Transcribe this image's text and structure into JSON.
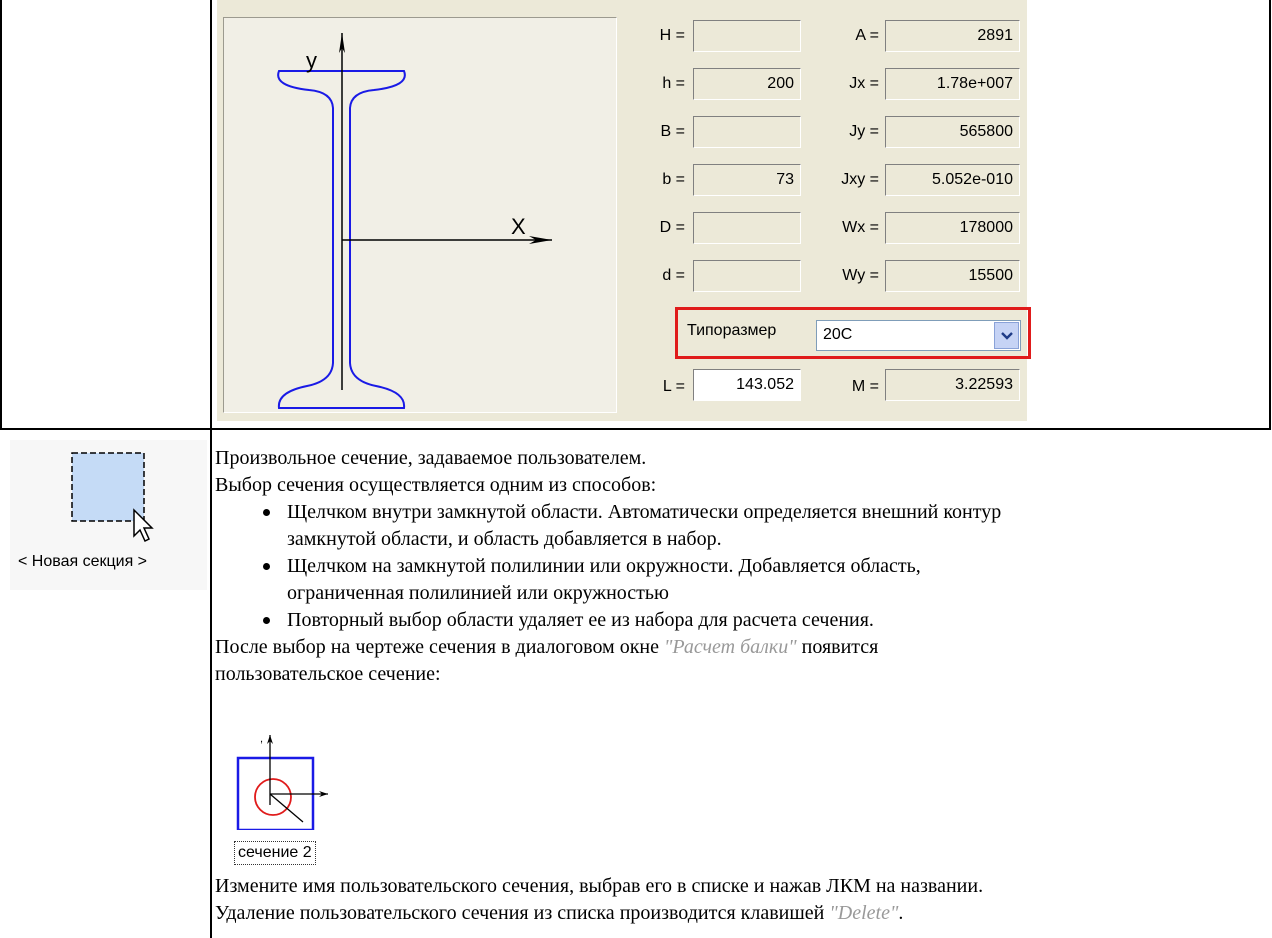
{
  "section_panel": {
    "fields": {
      "H": {
        "label": "H =",
        "value": ""
      },
      "h": {
        "label": "h =",
        "value": "200"
      },
      "B": {
        "label": "B =",
        "value": ""
      },
      "b": {
        "label": "b =",
        "value": "73"
      },
      "D": {
        "label": "D =",
        "value": ""
      },
      "d": {
        "label": "d =",
        "value": ""
      },
      "L": {
        "label": "L =",
        "value": "143.052"
      },
      "A": {
        "label": "A =",
        "value": "2891"
      },
      "Jx": {
        "label": "Jx =",
        "value": "1.78e+007"
      },
      "Jy": {
        "label": "Jy =",
        "value": "565800"
      },
      "Jxy": {
        "label": "Jxy =",
        "value": "5.052e-010"
      },
      "Wx": {
        "label": "Wx =",
        "value": "178000"
      },
      "Wy": {
        "label": "Wy =",
        "value": "15500"
      },
      "M": {
        "label": "M =",
        "value": "3.22593"
      }
    },
    "typesize": {
      "label": "Типоразмер",
      "value": "20С"
    },
    "preview": {
      "axis_y": "y",
      "axis_x": "X"
    },
    "colors": {
      "highlight": "#e01b1b",
      "profile": "#1a1ae6"
    }
  },
  "new_section": {
    "label": "< Новая секция >"
  },
  "description": {
    "line1": "Произвольное сечение, задаваемое пользователем.",
    "line2": "Выбор сечения осуществляется одним из способов:",
    "bullets": [
      {
        "l1": "Щелчком внутри замкнутой области. Автоматически определяется внешний контур",
        "l2": "замкнутой области, и область добавляется в набор."
      },
      {
        "l1": "Щелчком на замкнутой полилинии или окружности. Добавляется область,",
        "l2": "ограниченная полилинией или окружностью"
      },
      {
        "l1": "Повторный выбор области удаляет ее из набора для расчета сечения.",
        "l2": ""
      }
    ],
    "after_pre": "После выбор на чертеже сечения в диалоговом окне ",
    "after_ref": "\"Расчет балки\"",
    "after_post": " появится",
    "after_line2": "пользовательское сечение:",
    "user_section_label": "сечение 2",
    "rename_line": "Измените имя пользовательского сечения, выбрав его в списке и нажав ЛКМ на названии.",
    "delete_pre": "Удаление пользовательского сечения из списка производится клавишей ",
    "delete_ref": "\"Delete\"",
    "delete_post": "."
  }
}
